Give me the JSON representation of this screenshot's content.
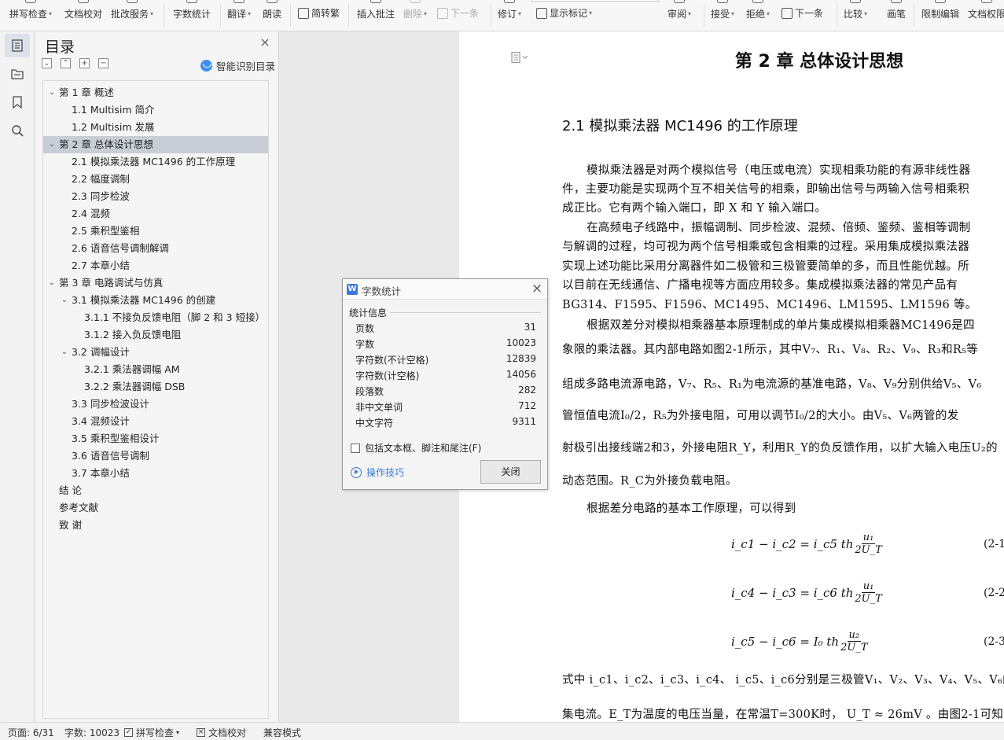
{
  "ribbon": {
    "items": [
      {
        "label": "拼写检查",
        "caret": true,
        "disabled": false
      },
      {
        "label": "文档校对",
        "caret": false,
        "disabled": false
      },
      {
        "label": "批改服务",
        "caret": true,
        "disabled": false
      },
      {
        "label": "字数统计",
        "caret": false,
        "disabled": false
      },
      {
        "label": "翻译",
        "caret": true,
        "disabled": false
      },
      {
        "label": "朗读",
        "caret": false,
        "disabled": false
      },
      {
        "label": "简转繁",
        "caret": false,
        "disabled": false
      },
      {
        "label": "插入批注",
        "caret": false,
        "disabled": false
      },
      {
        "label": "删除",
        "caret": true,
        "disabled": true
      },
      {
        "label": "下一条",
        "caret": false,
        "disabled": true
      },
      {
        "label": "修订",
        "caret": true,
        "disabled": false
      },
      {
        "label": "显示标记",
        "caret": true,
        "disabled": false
      },
      {
        "label": "审阅",
        "caret": true,
        "disabled": false
      },
      {
        "label": "接受",
        "caret": true,
        "disabled": false
      },
      {
        "label": "拒绝",
        "caret": true,
        "disabled": false
      },
      {
        "label": "下一条",
        "caret": false,
        "disabled": false
      },
      {
        "label": "比较",
        "caret": true,
        "disabled": false
      },
      {
        "label": "画笔",
        "caret": false,
        "disabled": false
      },
      {
        "label": "限制编辑",
        "caret": false,
        "disabled": false
      },
      {
        "label": "文档权限",
        "caret": false,
        "disabled": false
      }
    ]
  },
  "rail": {
    "icons": [
      "toc-icon",
      "navigation-icon",
      "bookmark-icon",
      "search-icon"
    ]
  },
  "toc": {
    "title": "目录",
    "smart_label": "智能识别目录",
    "items": [
      {
        "label": "第 1 章  概述",
        "level": 0,
        "expander": "open",
        "selected": false
      },
      {
        "label": "1.1 Multisim 简介",
        "level": 1,
        "expander": "",
        "selected": false
      },
      {
        "label": "1.2 Multisim 发展",
        "level": 1,
        "expander": "",
        "selected": false
      },
      {
        "label": "第 2 章  总体设计思想",
        "level": 0,
        "expander": "open",
        "selected": true
      },
      {
        "label": "2.1  模拟乘法器 MC1496 的工作原理",
        "level": 1,
        "expander": "",
        "selected": false
      },
      {
        "label": "2.2  幅度调制",
        "level": 1,
        "expander": "",
        "selected": false
      },
      {
        "label": "2.3  同步检波",
        "level": 1,
        "expander": "",
        "selected": false
      },
      {
        "label": "2.4  混频",
        "level": 1,
        "expander": "",
        "selected": false
      },
      {
        "label": "2.5  乘积型鉴相",
        "level": 1,
        "expander": "",
        "selected": false
      },
      {
        "label": "2.6  语音信号调制解调",
        "level": 1,
        "expander": "",
        "selected": false
      },
      {
        "label": "2.7  本章小结",
        "level": 1,
        "expander": "",
        "selected": false
      },
      {
        "label": "第 3 章  电路调试与仿真",
        "level": 0,
        "expander": "open",
        "selected": false
      },
      {
        "label": "3.1  模拟乘法器 MC1496 的创建",
        "level": 1,
        "expander": "open",
        "selected": false
      },
      {
        "label": "3.1.1  不接负反馈电阻（脚 2 和 3 短接）",
        "level": 2,
        "expander": "",
        "selected": false
      },
      {
        "label": "3.1.2  接入负反馈电阻",
        "level": 2,
        "expander": "",
        "selected": false
      },
      {
        "label": "3.2  调幅设计",
        "level": 1,
        "expander": "open",
        "selected": false
      },
      {
        "label": "3.2.1  乘法器调幅 AM",
        "level": 2,
        "expander": "",
        "selected": false
      },
      {
        "label": "3.2.2  乘法器调幅 DSB",
        "level": 2,
        "expander": "",
        "selected": false
      },
      {
        "label": "3.3  同步检波设计",
        "level": 1,
        "expander": "",
        "selected": false
      },
      {
        "label": "3.4  混频设计",
        "level": 1,
        "expander": "",
        "selected": false
      },
      {
        "label": "3.5  乘积型鉴相设计",
        "level": 1,
        "expander": "",
        "selected": false
      },
      {
        "label": "3.6  语音信号调制",
        "level": 1,
        "expander": "",
        "selected": false
      },
      {
        "label": "3.7  本章小结",
        "level": 1,
        "expander": "",
        "selected": false
      },
      {
        "label": "结  论",
        "level": 0,
        "expander": "",
        "selected": false
      },
      {
        "label": "参考文献",
        "level": 0,
        "expander": "",
        "selected": false
      },
      {
        "label": "致  谢",
        "level": 0,
        "expander": "",
        "selected": false
      }
    ]
  },
  "document": {
    "chapter_title": "第 2 章  总体设计思想",
    "section_title": "2.1  模拟乘法器 MC1496 的工作原理",
    "lines": [
      {
        "text": "模拟乘法器是对两个模拟信号（电压或电流）实现相乘功能的有源非线性器",
        "indent": true
      },
      {
        "text": "件，主要功能是实现两个互不相关信号的相乘，即输出信号与两输入信号相乘积",
        "indent": false
      },
      {
        "text": "成正比。它有两个输入端口，即 X 和 Y 输入端口。",
        "indent": false
      },
      {
        "text": "在高频电子线路中，振幅调制、同步检波、混频、倍频、鉴频、鉴相等调制",
        "indent": true
      },
      {
        "text": "与解调的过程，均可视为两个信号相乘或包含相乘的过程。采用集成模拟乘法器",
        "indent": false
      },
      {
        "text": "实现上述功能比采用分离器件如二极管和三极管要简单的多，而且性能优越。所",
        "indent": false
      },
      {
        "text": "以目前在无线通信、广播电视等方面应用较多。集成模拟乘法器的常见产品有",
        "indent": false
      },
      {
        "text": "BG314、F1595、F1596、MC1495、MC1496、LM1595、LM1596 等。",
        "indent": false
      },
      {
        "text": "根据双差分对模拟相乘器基本原理制成的单片集成模拟相乘器MC1496是四",
        "indent": true
      },
      {
        "text": "象限的乘法器。其内部电路如图2-1所示，其中V₇、R₁、V₈、R₂、V₉、R₃和R₅等",
        "indent": false
      },
      {
        "text": "组成多路电流源电路，V₇、R₅、R₁为电流源的基准电路，V₈、V₉分别供给V₅、V₆",
        "indent": false
      },
      {
        "text": "管恒值电流I₀/2，R₅为外接电阻，可用以调节I₀/2的大小。由V₅、V₆两管的发",
        "indent": false
      },
      {
        "text": "射极引出接线端2和3，外接电阻R_Y，利用R_Y的负反馈作用，以扩大输入电压U₂的",
        "indent": false
      },
      {
        "text": "动态范围。R_C为外接负载电阻。",
        "indent": false
      },
      {
        "text": "根据差分电路的基本工作原理，可以得到",
        "indent": true
      }
    ],
    "equations": [
      {
        "lhs": "i_c1 − i_c2 = i_c5 th",
        "num": "u₁",
        "den": "2U_T",
        "no": "(2-1"
      },
      {
        "lhs": "i_c4 − i_c3 = i_c6 th",
        "num": "u₁",
        "den": "2U_T",
        "no": "(2-2"
      },
      {
        "lhs": "i_c5 − i_c6 = I₀ th",
        "num": "u₂",
        "den": "2U_T",
        "no": "(2-3"
      }
    ],
    "tail_lines": [
      "式中 i_c1、i_c2、i_c3、i_c4、 i_c5、i_c6分别是三极管V₁、V₂、V₃、V₄、V₅、V₆的集电",
      "集电流。E_T为温度的电压当量，在常温T=300K时， U_T ≈ 26mV 。由图2-1可知，"
    ]
  },
  "dialog": {
    "title": "字数统计",
    "section": "统计信息",
    "stats": [
      {
        "label": "页数",
        "value": "31"
      },
      {
        "label": "字数",
        "value": "10023"
      },
      {
        "label": "字符数(不计空格)",
        "value": "12839"
      },
      {
        "label": "字符数(计空格)",
        "value": "14056"
      },
      {
        "label": "段落数",
        "value": "282"
      },
      {
        "label": "非中文单词",
        "value": "712"
      },
      {
        "label": "中文字符",
        "value": "9311"
      }
    ],
    "checkbox_label": "包括文本框、脚注和尾注(F)",
    "tips_label": "操作技巧",
    "close_label": "关闭"
  },
  "status": {
    "page": "页面: 6/31",
    "words": "字数: 10023",
    "spell": "拼写检查",
    "proof": "文档校对",
    "compat": "兼容模式"
  }
}
